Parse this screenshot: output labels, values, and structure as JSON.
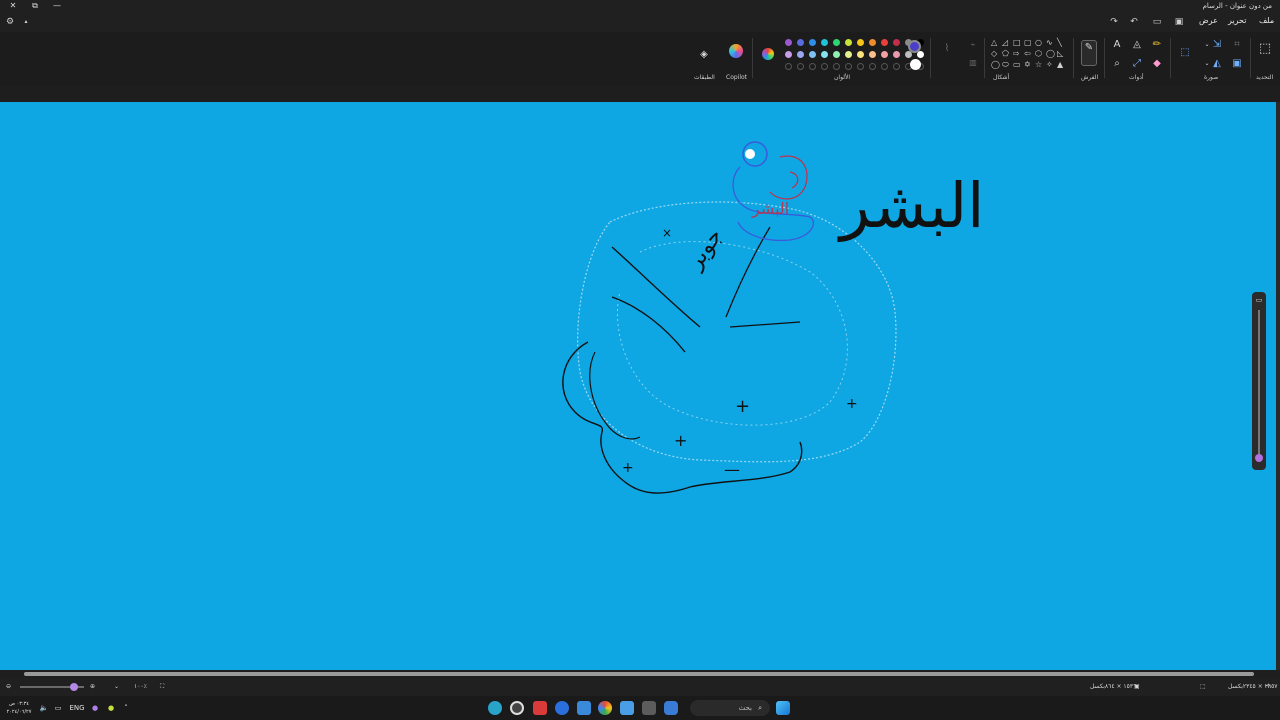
{
  "window": {
    "title": "من دون عنوان - الرسام",
    "controls": {
      "close": "✕",
      "restore": "⧉",
      "minimize": "—"
    }
  },
  "menu": {
    "file": "ملف",
    "edit": "تحرير",
    "view": "عرض"
  },
  "ribbon": {
    "groups": {
      "selection": "التحديد",
      "image": "صورة",
      "tools": "أدوات",
      "brushes": "الفرش",
      "shapes": "أشكال",
      "colors": "الألوان",
      "copilot": "Copilot",
      "layers": "الطبقات"
    },
    "palette_row1": [
      "#9b59d0",
      "#5a6be0",
      "#2d8fe6",
      "#22c3d6",
      "#2ed573",
      "#c7e33a",
      "#f5c518",
      "#f08c2e",
      "#e8413c",
      "#c0304a",
      "#8a8a8a",
      "#000000"
    ],
    "palette_row2": [
      "#c79be8",
      "#9aa7f0",
      "#7fc0f2",
      "#84e3ec",
      "#8ef0b2",
      "#e3f28a",
      "#fbe27a",
      "#f7c08a",
      "#f4a0a0",
      "#e89aac",
      "#bdbdbd",
      "#ffffff"
    ],
    "selected_primary": "#4a3fc8",
    "selected_secondary": "#ffffff"
  },
  "canvas": {
    "background": "#0ea7e4",
    "handwriting": {
      "main_word": "البشر",
      "cluster_label": "جوبر"
    }
  },
  "statusbar": {
    "canvas_size": "١٥٣٦ × ٨٦٤بكسل",
    "cursor_pos": "٢٦٥٧ × ٢٣٤٥بكسل",
    "zoom": "١٠٠٪"
  },
  "taskbar": {
    "search_placeholder": "بحث",
    "language": "ENG",
    "time": "٠٣:٣٤ ص",
    "date": "٢٠٢٤/٠٦/٢٧"
  }
}
